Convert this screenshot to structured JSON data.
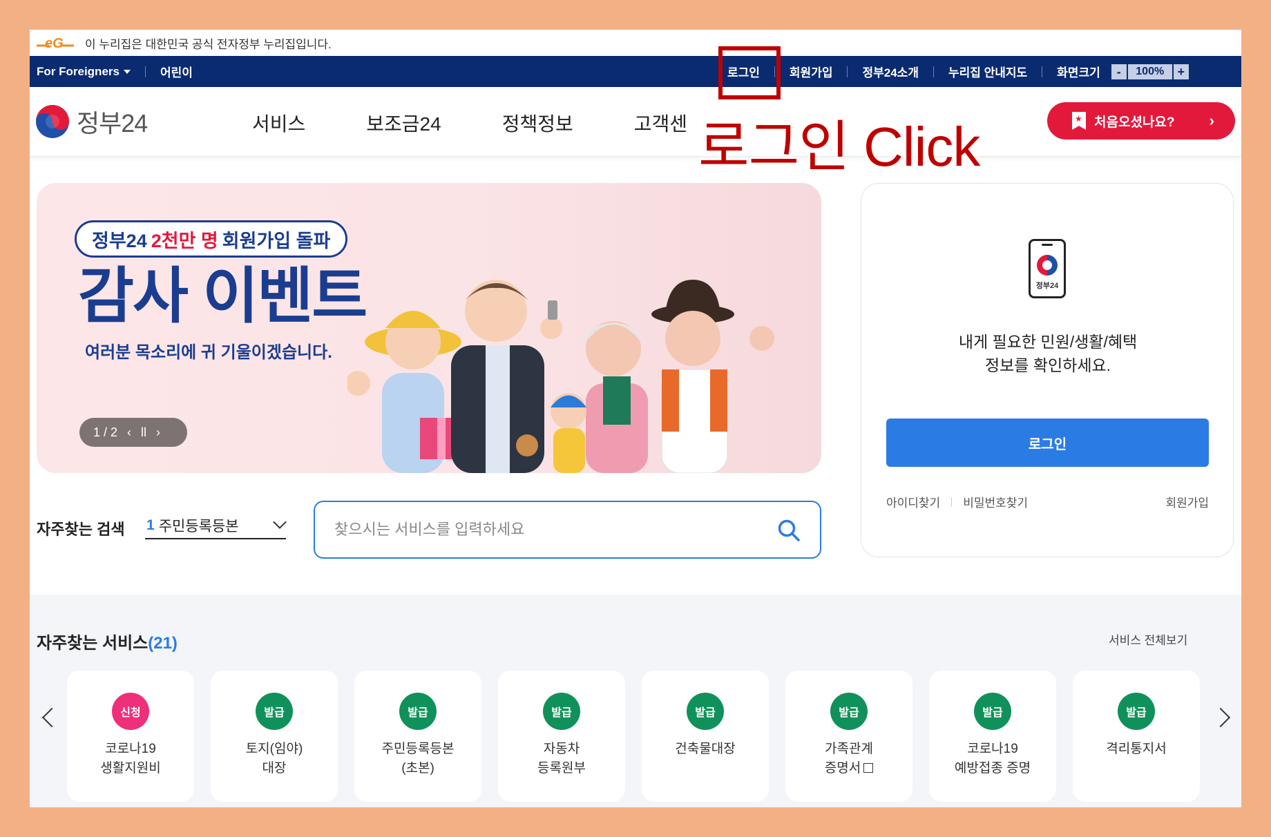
{
  "gov_banner": {
    "text": "이 누리집은 대한민국 공식 전자정부 누리집입니다."
  },
  "util": {
    "foreigners": "For Foreigners",
    "kids": "어린이",
    "login": "로그인",
    "signup": "회원가입",
    "about": "정부24소개",
    "sitemap": "누리집 안내지도",
    "zoom_label": "화면크기",
    "zoom_minus": "-",
    "zoom_value": "100%",
    "zoom_plus": "+"
  },
  "header": {
    "logo_text": "정부24",
    "nav": [
      "서비스",
      "보조금24",
      "정책정보",
      "고객센"
    ],
    "first_visit": "처음오셨나요?"
  },
  "overlay": {
    "instruction": "로그인 Click"
  },
  "banner": {
    "pill_prefix": "정부24",
    "pill_highlight": "2천만 명",
    "pill_suffix": "회원가입 돌파",
    "title": "감사 이벤트",
    "subtitle": "여러분 목소리에 귀 기울이겠습니다.",
    "pager": "1 / 2"
  },
  "login_panel": {
    "phone_label": "정부24",
    "message_line1": "내게 필요한 민원/생활/혜택",
    "message_line2": "정보를 확인하세요.",
    "login_button": "로그인",
    "find_id": "아이디찾기",
    "find_pw": "비밀번호찾기",
    "signup": "회원가입"
  },
  "search": {
    "freq_label": "자주찾는 검색",
    "freq_num": "1",
    "freq_item": "주민등록등본",
    "placeholder": "찾으시는 서비스를 입력하세요"
  },
  "services": {
    "title": "자주찾는 서비스",
    "count": "(21)",
    "view_all": "서비스 전체보기",
    "items": [
      {
        "badge": "신청",
        "name": "코로나19\n생활지원비"
      },
      {
        "badge": "발급",
        "name": "토지(임야)\n대장"
      },
      {
        "badge": "발급",
        "name": "주민등록등본\n(초본)"
      },
      {
        "badge": "발급",
        "name": "자동차\n등록원부"
      },
      {
        "badge": "발급",
        "name": "건축물대장"
      },
      {
        "badge": "발급",
        "name": "가족관계\n증명서"
      },
      {
        "badge": "발급",
        "name": "코로나19\n예방접종 증명"
      },
      {
        "badge": "발급",
        "name": "격리통지서"
      }
    ]
  },
  "colors": {
    "navy": "#0b2b70",
    "accent_blue": "#2b7be4",
    "brand_red": "#e3193b",
    "annotation_red": "#c00000",
    "frame": "#f4b085"
  }
}
